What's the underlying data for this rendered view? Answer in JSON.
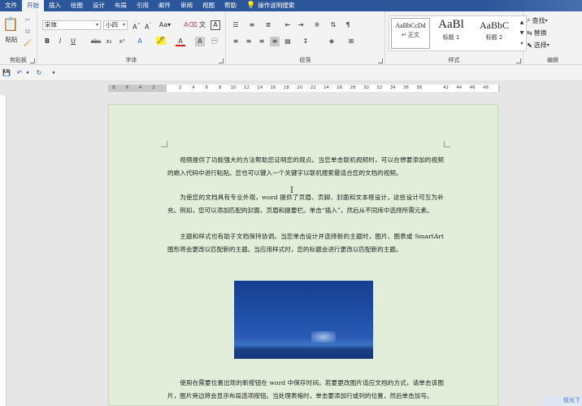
{
  "tabs": [
    "文件",
    "开始",
    "插入",
    "绘图",
    "设计",
    "布局",
    "引用",
    "邮件",
    "审阅",
    "视图",
    "帮助"
  ],
  "active_tab_index": 1,
  "tell_me": "操作说明搜索",
  "clipboard": {
    "paste": "粘贴",
    "label": "剪贴板"
  },
  "font": {
    "name": "宋体",
    "size": "小四",
    "label": "字体",
    "bold": "B",
    "italic": "I",
    "underline": "U",
    "strike": "abc",
    "sub": "x₂",
    "sup": "x²"
  },
  "paragraph": {
    "label": "段落"
  },
  "styles": {
    "label": "样式",
    "items": [
      {
        "sample": "AaBbCcDd",
        "name": "↵ 正文"
      },
      {
        "sample": "AaBl",
        "name": "标题 1"
      },
      {
        "sample": "AaBbC",
        "name": "标题 2"
      }
    ]
  },
  "editing": {
    "label": "编辑",
    "find": "查找",
    "replace": "替换",
    "select": "选择"
  },
  "ruler_ticks": [
    "8",
    "6",
    "4",
    "2",
    "",
    "2",
    "4",
    "6",
    "8",
    "10",
    "12",
    "14",
    "16",
    "18",
    "20",
    "22",
    "24",
    "26",
    "28",
    "30",
    "32",
    "34",
    "36",
    "38",
    "",
    "42",
    "44",
    "46",
    "48"
  ],
  "document": {
    "paragraphs": [
      "视频提供了功能强大的方法帮助您证明您的观点。当您单击联机视频时，可以在想要添加的视频的嵌入代码中进行粘贴。您也可以键入一个关键字以联机搜索最适合您的文档的视频。",
      "为使您的文档具有专业外观，word 提供了页眉、页脚、封面和文本框设计，这些设计可互为补充。例如，您可以添加匹配的封面、页眉和提要栏。单击“插入”，然后从不同库中选择所需元素。",
      "主题和样式也有助于文档保持协调。当您单击设计并选择新的主题时，图片、图表或 SmartArt 图形将会更改以匹配新的主题。当应用样式时，您的标题会进行更改以匹配新的主题。",
      "使用在需要位置出现的新按钮在 word 中保存时间。若要更改图片适应文档的方式，请单击该图片，图片旁边将会显示布局选项按钮。当处理表格时，单击要添加行或列的位置，然后单击加号。"
    ]
  },
  "watermark": "极光下"
}
